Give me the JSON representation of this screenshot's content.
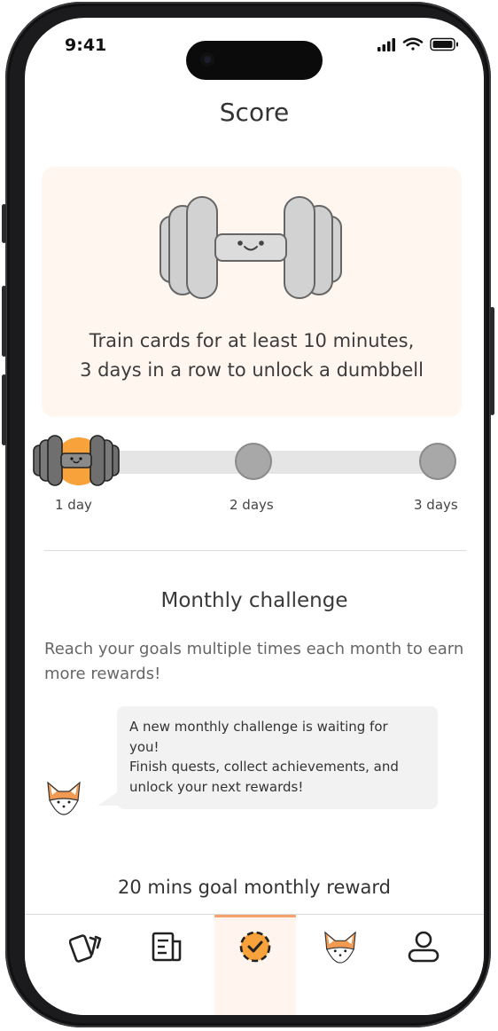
{
  "status_bar": {
    "time": "9:41",
    "icons": [
      "cellular-signal-icon",
      "wifi-icon",
      "battery-icon"
    ]
  },
  "page": {
    "title": "Score"
  },
  "streak_card": {
    "illustration": "smiling-dumbbell",
    "line1": "Train cards for at least 10 minutes,",
    "line2": "3 days  in a row to unlock a dumbbell"
  },
  "streak_progress": {
    "days_completed": 1,
    "days_total": 3,
    "stages": [
      {
        "label": "1 day",
        "state": "completed"
      },
      {
        "label": "2 days",
        "state": "locked"
      },
      {
        "label": "3 days",
        "state": "locked"
      }
    ]
  },
  "monthly_challenge": {
    "title": "Monthly challenge",
    "description": "Reach your goals multiple times each month to earn more rewards!",
    "message_lines": [
      "A new monthly challenge is waiting for",
      "you!",
      "Finish quests, collect achievements, and",
      "unlock your next rewards!"
    ],
    "reward_title": "20 mins goal monthly reward"
  },
  "tab_bar": {
    "active": "score",
    "tabs": [
      {
        "name": "cards",
        "icon": "cards-icon"
      },
      {
        "name": "notes",
        "icon": "notes-icon"
      },
      {
        "name": "score",
        "icon": "score-check-icon"
      },
      {
        "name": "fox",
        "icon": "fox-icon"
      },
      {
        "name": "profile",
        "icon": "profile-icon"
      }
    ]
  },
  "colors": {
    "accent_orange": "#f7a23a",
    "progress_fill": "#ffbf7a",
    "card_background": "#fff7ef",
    "active_tab_background": "#fff4ee",
    "locked_stage": "#a8a8a8"
  }
}
